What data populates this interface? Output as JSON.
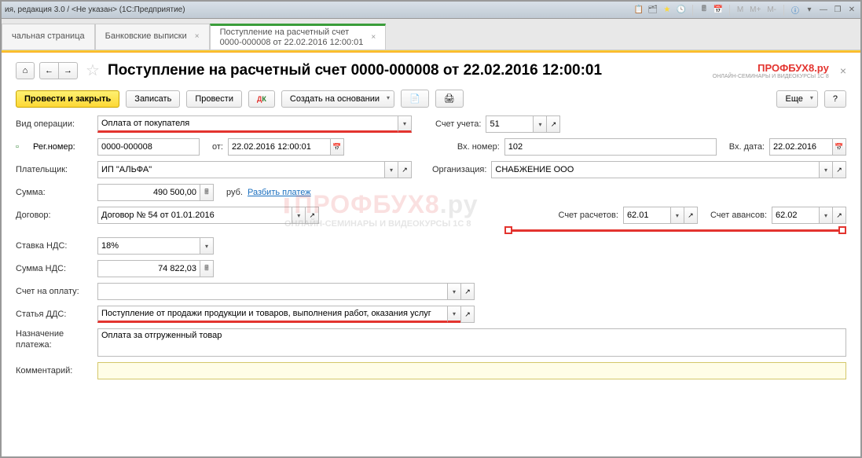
{
  "titlebar": "ия, редакция 3.0 / <Не указан>  (1С:Предприятие)",
  "ms": {
    "m": "M",
    "mp": "M+",
    "mm": "M-"
  },
  "tabs": {
    "t1": "чальная страница",
    "t2": "Банковские выписки",
    "t3": "Поступление на расчетный счет\n0000-000008 от 22.02.2016 12:00:01"
  },
  "page_title": "Поступление на расчетный счет 0000-000008 от 22.02.2016 12:00:01",
  "logo": "ПРОФБУХ8.ру",
  "logo_sub": "ОНЛАЙН-СЕМИНАРЫ И ВИДЕОКУРСЫ 1С 8",
  "toolbar": {
    "commit": "Провести и закрыть",
    "save": "Записать",
    "post": "Провести",
    "create_based": "Создать на основании",
    "more": "Еще"
  },
  "labels": {
    "op_type": "Вид операции:",
    "account": "Счет учета:",
    "reg_no": "Рег.номер:",
    "from": "от:",
    "in_no": "Вх. номер:",
    "in_date": "Вх. дата:",
    "payer": "Плательщик:",
    "org": "Организация:",
    "sum": "Сумма:",
    "rub": "руб.",
    "split": "Разбить платеж",
    "contract": "Договор:",
    "acc_calc": "Счет расчетов:",
    "acc_adv": "Счет авансов:",
    "vat_rate": "Ставка НДС:",
    "vat_sum": "Сумма НДС:",
    "invoice": "Счет на оплату:",
    "dds": "Статья ДДС:",
    "purpose": "Назначение платежа:",
    "comment": "Комментарий:"
  },
  "values": {
    "op_type": "Оплата от покупателя",
    "account": "51",
    "reg_no": "0000-000008",
    "from": "22.02.2016 12:00:01",
    "in_no": "102",
    "in_date": "22.02.2016",
    "payer": "ИП \"АЛЬФА\"",
    "org": "СНАБЖЕНИЕ ООО",
    "sum": "490 500,00",
    "contract": "Договор № 54 от 01.01.2016",
    "acc_calc": "62.01",
    "acc_adv": "62.02",
    "vat_rate": "18%",
    "vat_sum": "74 822,03",
    "invoice": "",
    "dds": "Поступление от продажи продукции и товаров, выполнения работ, оказания услуг",
    "purpose": "Оплата за отгруженный товар",
    "comment": ""
  }
}
